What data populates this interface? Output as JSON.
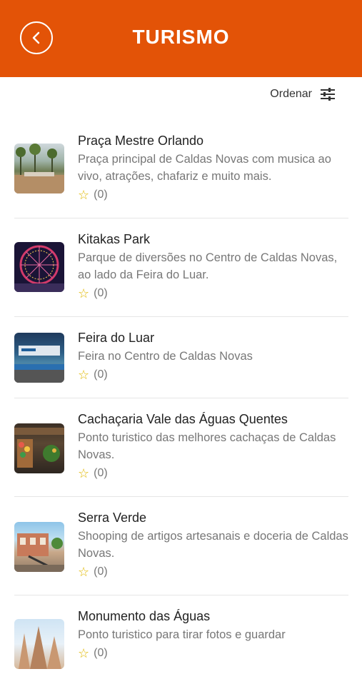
{
  "header": {
    "title": "TURISMO"
  },
  "sort": {
    "label": "Ordenar"
  },
  "items": [
    {
      "name": "Praça Mestre Orlando",
      "description": "Praça principal de Caldas Novas com musica ao vivo, atrações, chafariz e muito mais.",
      "rating": "(0)",
      "thumb_icon": "plaza-photo"
    },
    {
      "name": "Kitakas Park",
      "description": "Parque de diversões no Centro de Caldas Novas, ao lado da Feira do Luar.",
      "rating": "(0)",
      "thumb_icon": "ferris-wheel-photo"
    },
    {
      "name": "Feira do Luar",
      "description": "Feira no Centro de Caldas Novas",
      "rating": "(0)",
      "thumb_icon": "market-photo"
    },
    {
      "name": "Cachaçaria Vale das Águas Quentes",
      "description": "Ponto turistico das melhores cachaças de Caldas Novas.",
      "rating": "(0)",
      "thumb_icon": "store-photo"
    },
    {
      "name": "Serra Verde",
      "description": "Shooping de artigos artesanais e doceria de Caldas Novas.",
      "rating": "(0)",
      "thumb_icon": "shopping-photo"
    },
    {
      "name": "Monumento das Águas",
      "description": "Ponto turistico para tirar fotos e guardar",
      "rating": "(0)",
      "thumb_icon": "monument-photo"
    }
  ],
  "colors": {
    "header": "#e35307",
    "star": "#e0b800"
  }
}
